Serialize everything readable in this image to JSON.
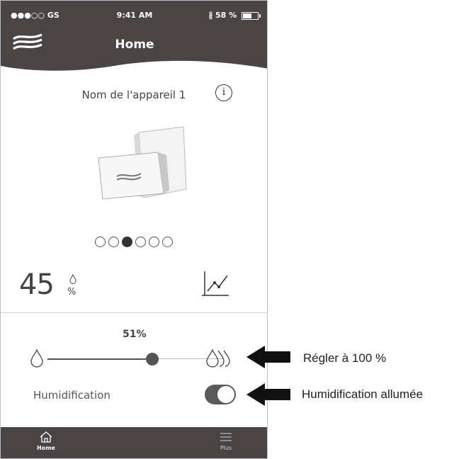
{
  "status_bar": {
    "carrier": "●●●○○ GS",
    "time": "9:41 AM",
    "battery": "58 %",
    "battery_level": 0.58
  },
  "header": {
    "title": "Home"
  },
  "device": {
    "name": "Nom de l'appareil 1",
    "info_icon": "i"
  },
  "carousel": {
    "count": 6,
    "active_index": 2
  },
  "current_humidity": {
    "value": "45",
    "unit": "%"
  },
  "slider": {
    "value_label": "51%",
    "value": 51
  },
  "humidification": {
    "label": "Humidification",
    "on": true
  },
  "tabbar": {
    "home_label": "Home",
    "plus_label": "Plus"
  },
  "annotations": {
    "slider_note": "Régler à 100 %",
    "toggle_note": "Humidification allumée"
  },
  "colors": {
    "header_bg": "#4a4444",
    "accent": "#555555"
  }
}
